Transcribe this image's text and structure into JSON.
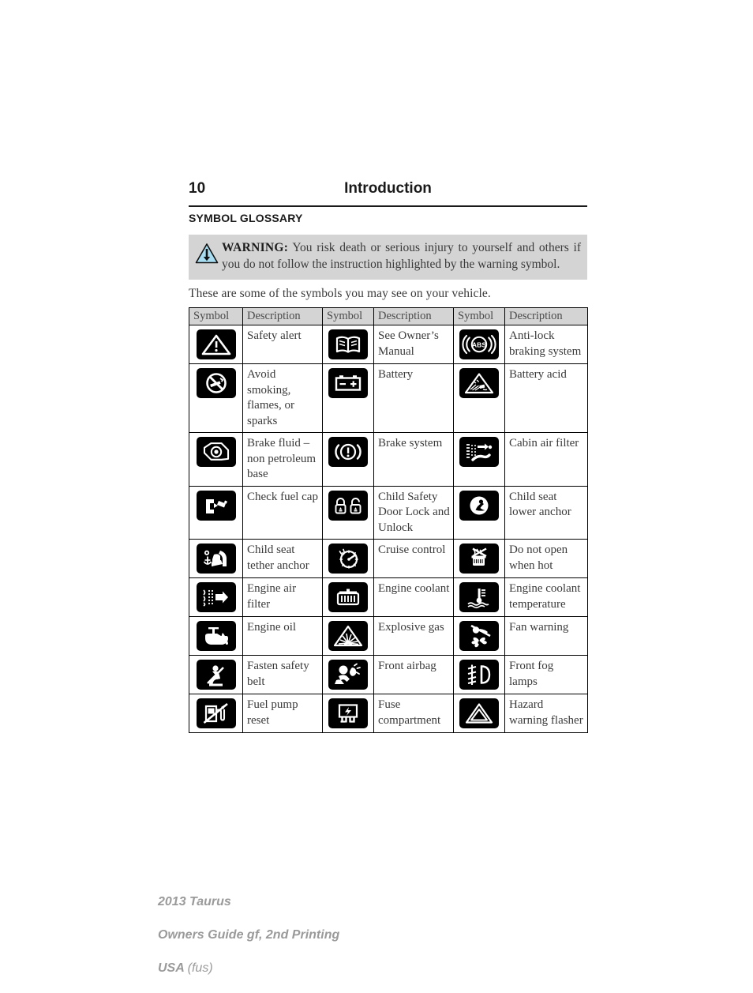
{
  "header": {
    "page_number": "10",
    "title": "Introduction"
  },
  "section_heading": "SYMBOL GLOSSARY",
  "warning": {
    "icon": "warning-triangle-icon",
    "label": "WARNING:",
    "text": " You risk death or serious injury to yourself and others if you do not follow the instruction highlighted by the warning symbol.",
    "background": "#d4d4d4",
    "triangle_fill": "#a8dcf0"
  },
  "intro_line": "These are some of the symbols you may see on your vehicle.",
  "table": {
    "headers": [
      "Symbol",
      "Description",
      "Symbol",
      "Description",
      "Symbol",
      "Description"
    ],
    "rows": [
      [
        {
          "icon": "safety-alert-icon",
          "desc": "Safety alert"
        },
        {
          "icon": "owners-manual-icon",
          "desc": "See Owner’s Manual"
        },
        {
          "icon": "anti-lock-braking-icon",
          "desc": "Anti-lock braking system"
        }
      ],
      [
        {
          "icon": "no-smoking-icon",
          "desc": "Avoid smoking, flames, or sparks"
        },
        {
          "icon": "battery-icon",
          "desc": "Battery"
        },
        {
          "icon": "battery-acid-icon",
          "desc": "Battery acid"
        }
      ],
      [
        {
          "icon": "brake-fluid-icon",
          "desc": "Brake fluid – non petroleum base"
        },
        {
          "icon": "brake-system-icon",
          "desc": "Brake system"
        },
        {
          "icon": "cabin-air-filter-icon",
          "desc": "Cabin air filter"
        }
      ],
      [
        {
          "icon": "check-fuel-cap-icon",
          "desc": "Check fuel cap"
        },
        {
          "icon": "child-safety-door-lock-icon",
          "desc": "Child Safety Door Lock and Unlock"
        },
        {
          "icon": "child-seat-lower-anchor-icon",
          "desc": "Child seat lower anchor"
        }
      ],
      [
        {
          "icon": "child-seat-tether-anchor-icon",
          "desc": "Child seat tether anchor"
        },
        {
          "icon": "cruise-control-icon",
          "desc": "Cruise control"
        },
        {
          "icon": "do-not-open-when-hot-icon",
          "desc": "Do not open when hot"
        }
      ],
      [
        {
          "icon": "engine-air-filter-icon",
          "desc": "Engine air filter"
        },
        {
          "icon": "engine-coolant-icon",
          "desc": "Engine coolant"
        },
        {
          "icon": "engine-coolant-temperature-icon",
          "desc": "Engine coolant temperature"
        }
      ],
      [
        {
          "icon": "engine-oil-icon",
          "desc": "Engine oil"
        },
        {
          "icon": "explosive-gas-icon",
          "desc": "Explosive gas"
        },
        {
          "icon": "fan-warning-icon",
          "desc": "Fan warning"
        }
      ],
      [
        {
          "icon": "fasten-safety-belt-icon",
          "desc": "Fasten safety belt"
        },
        {
          "icon": "front-airbag-icon",
          "desc": "Front airbag"
        },
        {
          "icon": "front-fog-lamps-icon",
          "desc": "Front fog lamps"
        }
      ],
      [
        {
          "icon": "fuel-pump-reset-icon",
          "desc": "Fuel pump reset"
        },
        {
          "icon": "fuse-compartment-icon",
          "desc": "Fuse compartment"
        },
        {
          "icon": "hazard-warning-flasher-icon",
          "desc": "Hazard warning flasher"
        }
      ]
    ]
  },
  "footer": {
    "line1": "2013 Taurus",
    "line2": "Owners Guide gf, 2nd Printing",
    "line3": "USA",
    "line3_suffix": "(fus)",
    "color": "#9a9a9a"
  }
}
